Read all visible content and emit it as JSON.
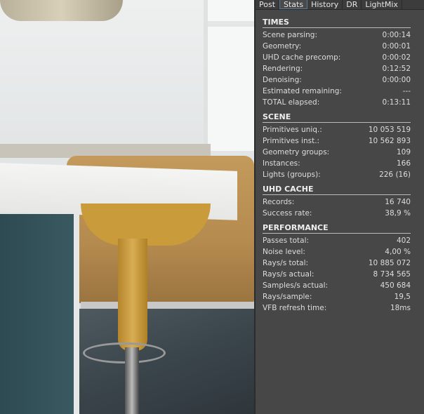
{
  "tabs": [
    "Post",
    "Stats",
    "History",
    "DR",
    "LightMix"
  ],
  "active_tab": "Stats",
  "sections": [
    {
      "title": "TIMES",
      "rows": [
        [
          "Scene parsing:",
          "0:00:14"
        ],
        [
          "Geometry:",
          "0:00:01"
        ],
        [
          "UHD cache precomp:",
          "0:00:02"
        ],
        [
          "Rendering:",
          "0:12:52"
        ],
        [
          "Denoising:",
          "0:00:00"
        ],
        [
          "Estimated remaining:",
          "---"
        ],
        [
          "TOTAL elapsed:",
          "0:13:11"
        ]
      ]
    },
    {
      "title": "SCENE",
      "rows": [
        [
          "Primitives uniq.:",
          "10 053 519"
        ],
        [
          "Primitives inst.:",
          "10 562 893"
        ],
        [
          "Geometry groups:",
          "109"
        ],
        [
          "Instances:",
          "166"
        ],
        [
          "Lights (groups):",
          "226 (16)"
        ]
      ]
    },
    {
      "title": "UHD CACHE",
      "rows": [
        [
          "Records:",
          "16 740"
        ],
        [
          "Success rate:",
          "38,9 %"
        ]
      ]
    },
    {
      "title": "PERFORMANCE",
      "rows": [
        [
          "Passes total:",
          "402"
        ],
        [
          "Noise level:",
          "4,00 %"
        ],
        [
          "Rays/s total:",
          "10 885 072"
        ],
        [
          "Rays/s actual:",
          "8 734 565"
        ],
        [
          "Samples/s actual:",
          "450 684"
        ],
        [
          "Rays/sample:",
          "19,5"
        ],
        [
          "VFB refresh time:",
          "18ms"
        ]
      ]
    }
  ]
}
